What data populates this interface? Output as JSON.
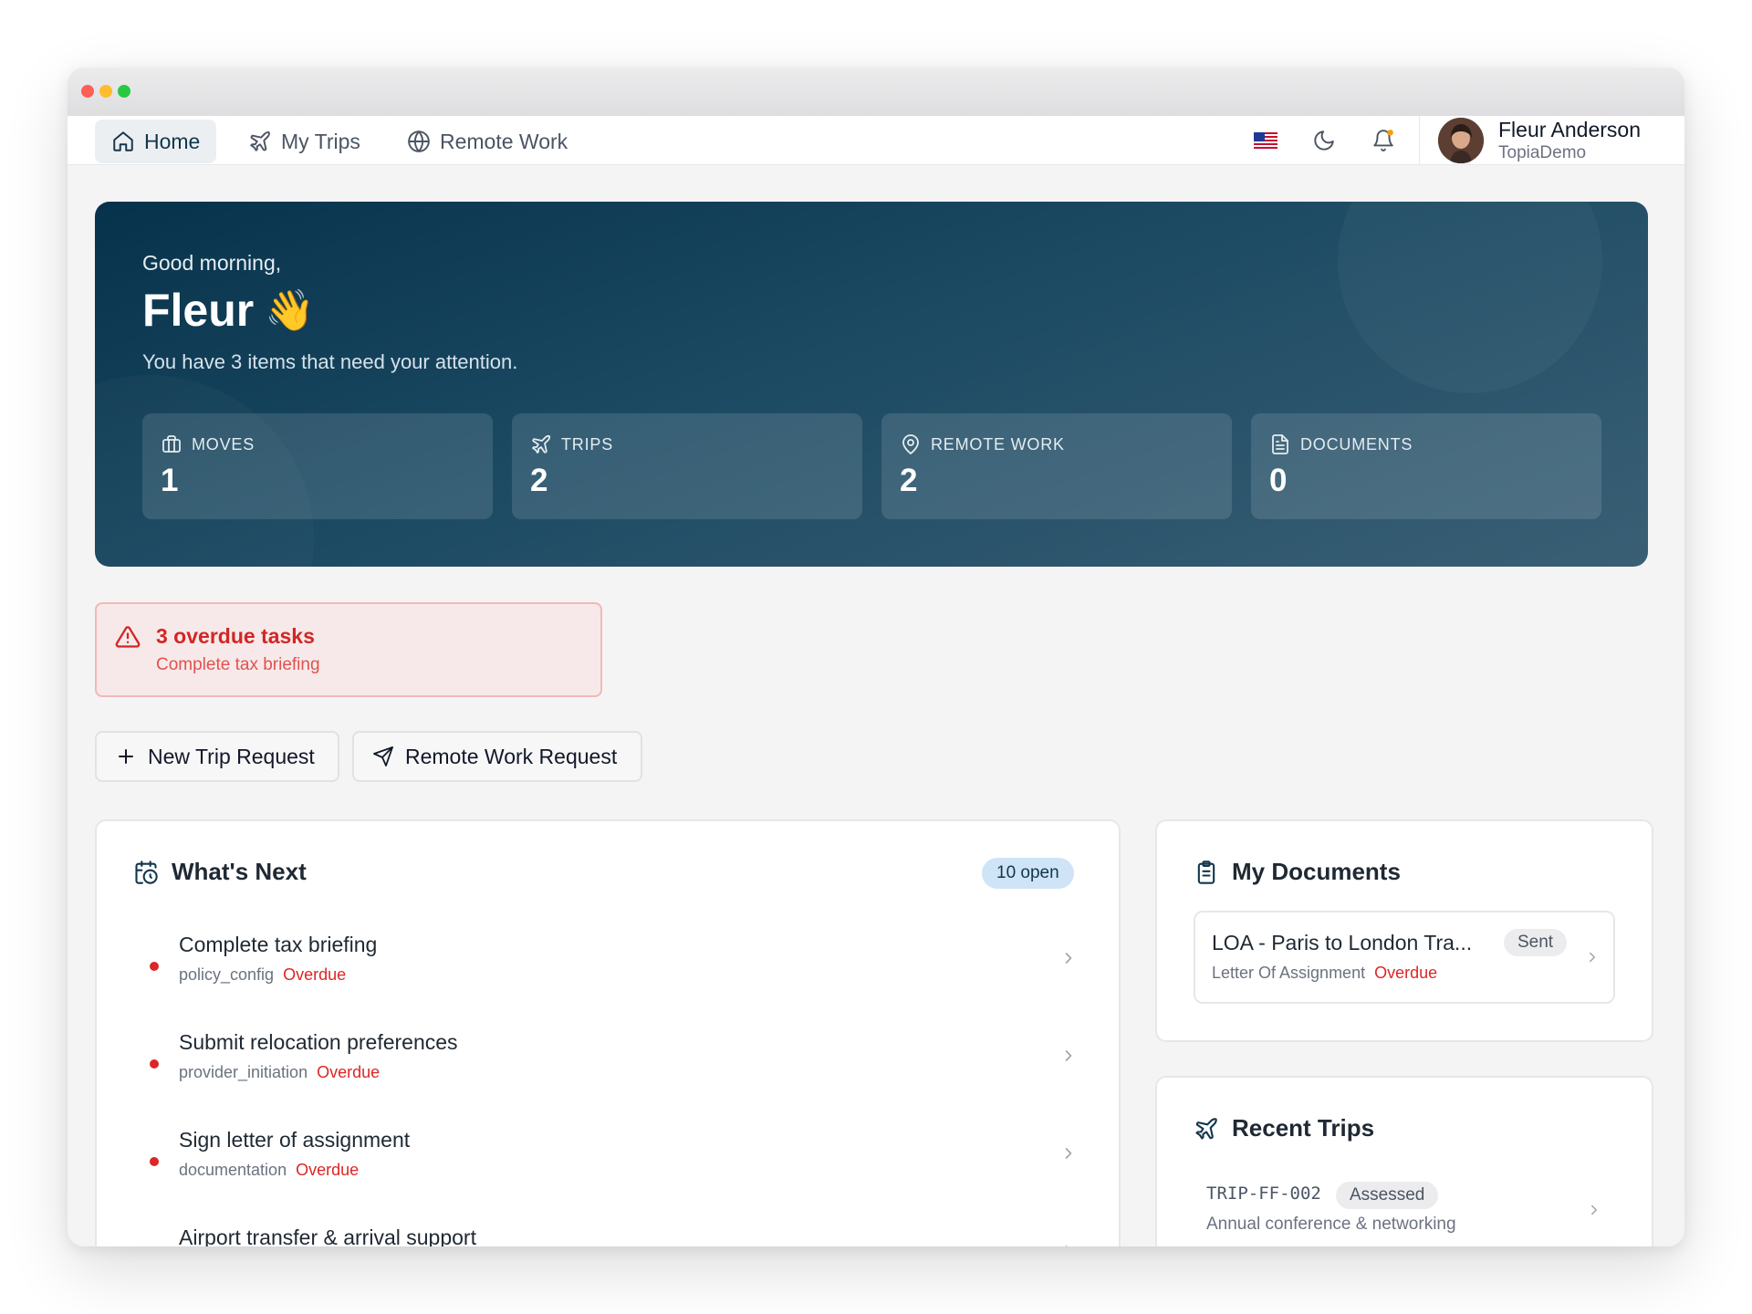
{
  "nav": {
    "tabs": [
      {
        "label": "Home",
        "icon": "home-icon",
        "active": true
      },
      {
        "label": "My Trips",
        "icon": "plane-icon",
        "active": false
      },
      {
        "label": "Remote Work",
        "icon": "globe-icon",
        "active": false
      }
    ],
    "language_flag": "us-flag-icon",
    "theme_icon": "moon-icon",
    "notifications_icon": "bell-icon",
    "user": {
      "name": "Fleur Anderson",
      "org": "TopiaDemo"
    }
  },
  "hero": {
    "greeting": "Good morning,",
    "name": "Fleur",
    "wave": "👋",
    "subtitle": "You have 3 items that need your attention.",
    "stats": [
      {
        "label": "MOVES",
        "value": "1",
        "icon": "briefcase-icon"
      },
      {
        "label": "TRIPS",
        "value": "2",
        "icon": "plane-icon"
      },
      {
        "label": "REMOTE WORK",
        "value": "2",
        "icon": "map-pin-icon"
      },
      {
        "label": "DOCUMENTS",
        "value": "0",
        "icon": "document-icon"
      }
    ]
  },
  "alert": {
    "title": "3 overdue tasks",
    "subtitle": "Complete tax briefing"
  },
  "actions": {
    "new_trip": "New Trip Request",
    "remote_work": "Remote Work Request"
  },
  "whats_next": {
    "title": "What's Next",
    "badge": "10 open",
    "tasks": [
      {
        "title": "Complete tax briefing",
        "category": "policy_config",
        "status": "Overdue"
      },
      {
        "title": "Submit relocation preferences",
        "category": "provider_initiation",
        "status": "Overdue"
      },
      {
        "title": "Sign letter of assignment",
        "category": "documentation",
        "status": "Overdue"
      },
      {
        "title": "Airport transfer & arrival support",
        "category": "",
        "status": ""
      }
    ]
  },
  "documents": {
    "title": "My Documents",
    "items": [
      {
        "title": "LOA - Paris to London Tra...",
        "type": "Letter Of Assignment",
        "status": "Overdue",
        "badge": "Sent"
      }
    ]
  },
  "recent_trips": {
    "title": "Recent Trips",
    "items": [
      {
        "code": "TRIP-FF-002",
        "status": "Assessed",
        "description": "Annual conference & networking"
      }
    ]
  },
  "colors": {
    "accent": "#12364d",
    "hero_dark": "#07324b",
    "danger": "#dc2626",
    "badge_blue": "#cfe4f7"
  }
}
